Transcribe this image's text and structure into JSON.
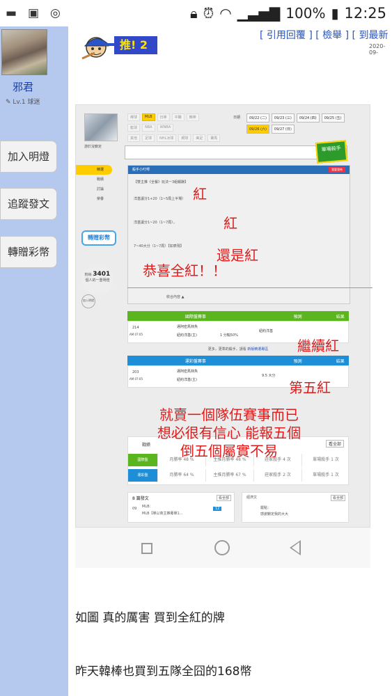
{
  "statusbar": {
    "battery": "100%",
    "time": "12:25",
    "icons": [
      "chat-icon",
      "image-icon",
      "chrome-icon",
      "lock-icon",
      "alarm-icon",
      "wifi-icon",
      "signal-icon",
      "battery-icon"
    ]
  },
  "user": {
    "name": "邪君",
    "level": "Lv.1 球迷"
  },
  "sidebar_buttons": [
    "加入明燈",
    "追蹤發文",
    "轉贈彩幣"
  ],
  "post_header": {
    "badge": "推!",
    "badge_count": "2",
    "links": "[ 引用回覆 ] [ 檢舉 ] [ 到最新",
    "date": "2020-09-"
  },
  "screenshot": {
    "profile_label": "游於沒鎖定",
    "filters": {
      "row1": [
        "棒球",
        "MLB",
        "日棒",
        "中職",
        "韓棒"
      ],
      "row2": [
        "籃球",
        "NBA",
        "WNBA"
      ],
      "row3": [
        "其他",
        "足球",
        "NHL冰球",
        "網球",
        "美足",
        "賽馬"
      ]
    },
    "date_label": "日期",
    "dates": [
      "09/22 (二)",
      "09/23 (三)",
      "09/24 (四)",
      "09/25 (五)",
      "09/26 (六)",
      "09/27 (日)"
    ],
    "active_date": "09/26 (六)",
    "king_badge": "單場殺手",
    "menu": [
      "精選",
      "戰績",
      "討論",
      "榮譽"
    ],
    "gift_button": "轉贈彩幣",
    "followers_label": "粉絲",
    "followers_count": "3401",
    "followers_sub": "個人的一重明燈",
    "join_button": "加入明燈",
    "panel_title": "殺手小叮嚀",
    "panel_btn": "我要發佈",
    "post_lines": [
      "【雙主推《全餐》玩法一3組報酬】",
      "洋基讓分1+20（1~5局上半場）",
      "洋基讓分1~20（1~7局）。",
      "7~40大分（1~7局）【如表現】"
    ],
    "annotations": {
      "red1": "紅",
      "red2": "紅",
      "red3": "還是紅",
      "red4": "恭喜全紅！！",
      "red5": "繼續紅",
      "red6": "第五紅"
    },
    "expand_label": "收合內容",
    "table1": {
      "headers": [
        "國際盤賽事",
        "預測",
        "結果"
      ],
      "game_no": "214",
      "time": "AM 07:05",
      "team1": "邁阿密馬林魚",
      "team2": "紐約洋基(主)",
      "line": "1 分輸50%",
      "pick": "紐約洋基",
      "note": "更多，更準的殺手，請看",
      "note_link": "新版精選專區"
    },
    "table2": {
      "headers": [
        "運彩盤賽事",
        "預測",
        "結果"
      ],
      "game_no": "203",
      "time": "AM 07:05",
      "team1": "邁阿密馬林魚",
      "team2": "紐約洋基(主)",
      "pick": "9.5 大分"
    },
    "big_red": [
      "就賣一個隊伍賽事而已",
      "想必很有信心 能報五個",
      "倒五個屬實不易"
    ],
    "stats": {
      "title": "戰績",
      "see_all": "看全部",
      "rows": [
        {
          "label": "國際盤",
          "month": "月勝率 48 %",
          "main": "主推月勝率 48 %",
          "killer": "莊家殺手 4 次",
          "single": "單場殺手 1 次"
        },
        {
          "label": "運彩盤",
          "month": "月勝率 64 %",
          "main": "主推月勝率 67 %",
          "killer": "莊家殺手 2 次",
          "single": "單場殺手 1 次"
        }
      ]
    },
    "card1": {
      "title": "8 篇發文",
      "see_all": "看全部",
      "date": "09",
      "line1": "MLB：",
      "line2": "MLB【單以商主推專單1...",
      "tag": "12"
    },
    "card2": {
      "title": "經濟文",
      "see_all": "看全部",
      "line1": "罷點：",
      "line2": "感謝鎖定我的大大"
    }
  },
  "captions": [
    "如圖 真的厲害 買到全紅的牌",
    "昨天韓棒也買到五隊全囧的168幣"
  ],
  "colors": {
    "sidebar": "#b5c8ee",
    "link": "#2a55b8",
    "annotation_red": "#e01b1b",
    "green": "#5bb51f",
    "blue": "#1e8fd6"
  }
}
